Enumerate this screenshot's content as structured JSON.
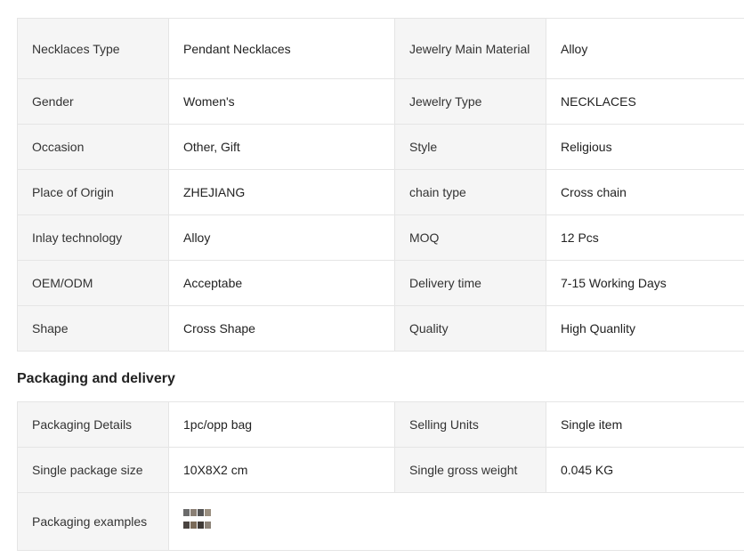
{
  "specs": [
    [
      {
        "k": "Necklaces Type",
        "v": "Pendant Necklaces"
      },
      {
        "k": "Jewelry Main Material",
        "v": "Alloy"
      }
    ],
    [
      {
        "k": "Gender",
        "v": "Women's"
      },
      {
        "k": "Jewelry Type",
        "v": "NECKLACES"
      }
    ],
    [
      {
        "k": "Occasion",
        "v": "Other, Gift"
      },
      {
        "k": "Style",
        "v": "Religious"
      }
    ],
    [
      {
        "k": "Place of Origin",
        "v": "ZHEJIANG"
      },
      {
        "k": "chain type",
        "v": "Cross chain"
      }
    ],
    [
      {
        "k": "Inlay technology",
        "v": "Alloy"
      },
      {
        "k": "MOQ",
        "v": "12 Pcs"
      }
    ],
    [
      {
        "k": "OEM/ODM",
        "v": "Acceptabe"
      },
      {
        "k": "Delivery time",
        "v": "7-15 Working Days"
      }
    ],
    [
      {
        "k": "Shape",
        "v": "Cross Shape"
      },
      {
        "k": "Quality",
        "v": "High Quanlity"
      }
    ]
  ],
  "packaging": {
    "title": "Packaging and delivery",
    "rows": [
      [
        {
          "k": "Packaging Details",
          "v": "1pc/opp bag"
        },
        {
          "k": "Selling Units",
          "v": "Single item"
        }
      ],
      [
        {
          "k": "Single package size",
          "v": "10X8X2 cm"
        },
        {
          "k": "Single gross weight",
          "v": "0.045 KG"
        }
      ]
    ],
    "examples_label": "Packaging examples",
    "thumb_colors": [
      "#6b6b6b",
      "#8a7f74",
      "#555555",
      "#9a8f80",
      "#4a4440",
      "#7a6a58",
      "#3f3a36",
      "#8c8378"
    ]
  }
}
